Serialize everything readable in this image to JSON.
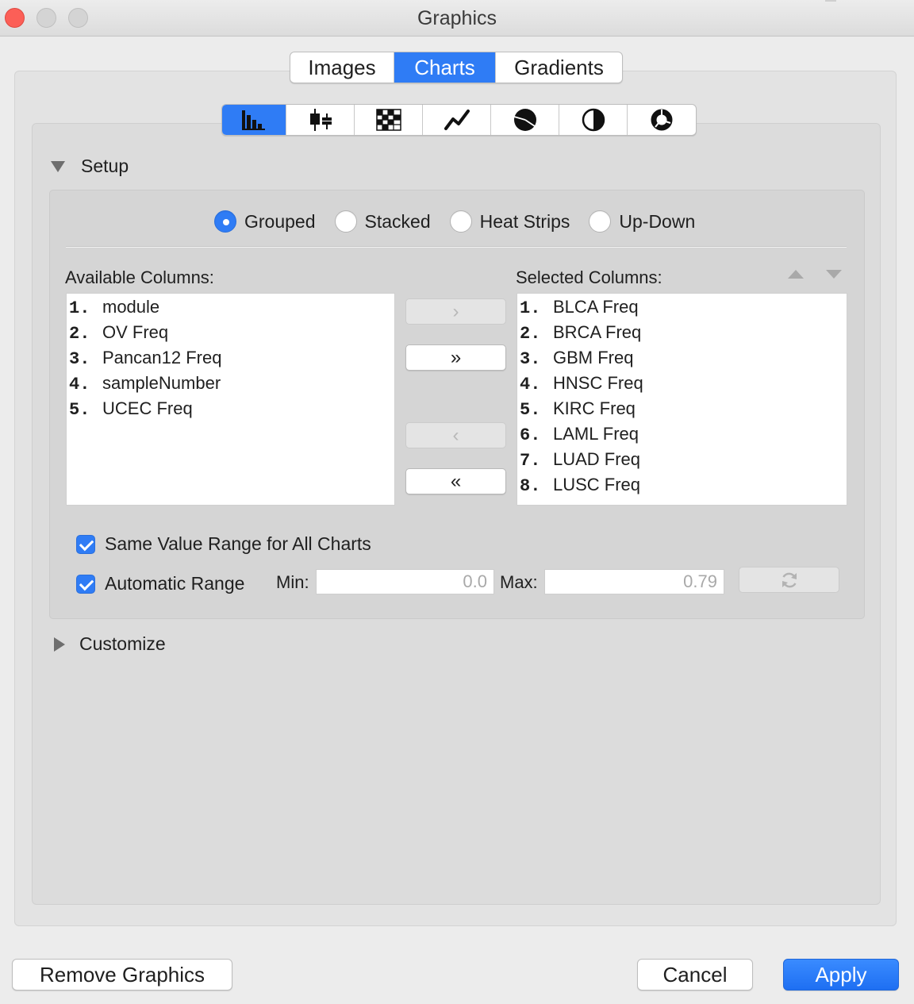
{
  "window": {
    "title": "Graphics"
  },
  "main_tabs": [
    {
      "label": "Images",
      "active": false
    },
    {
      "label": "Charts",
      "active": true
    },
    {
      "label": "Gradients",
      "active": false
    }
  ],
  "chart_types": [
    {
      "icon": "bar-chart-icon",
      "active": true
    },
    {
      "icon": "box-plot-icon",
      "active": false
    },
    {
      "icon": "heat-map-icon",
      "active": false
    },
    {
      "icon": "line-chart-icon",
      "active": false
    },
    {
      "icon": "pie-chart-icon",
      "active": false
    },
    {
      "icon": "stripe-chart-icon",
      "active": false
    },
    {
      "icon": "ring-chart-icon",
      "active": false
    }
  ],
  "setup": {
    "title": "Setup",
    "layout_options": [
      {
        "label": "Grouped",
        "selected": true
      },
      {
        "label": "Stacked",
        "selected": false
      },
      {
        "label": "Heat Strips",
        "selected": false
      },
      {
        "label": "Up-Down",
        "selected": false
      }
    ],
    "available_label": "Available Columns:",
    "selected_label": "Selected Columns:",
    "available_columns": [
      {
        "num": "1.",
        "name": "module"
      },
      {
        "num": "2.",
        "name": "OV Freq"
      },
      {
        "num": "3.",
        "name": "Pancan12 Freq"
      },
      {
        "num": "4.",
        "name": "sampleNumber"
      },
      {
        "num": "5.",
        "name": "UCEC Freq"
      }
    ],
    "selected_columns": [
      {
        "num": "1.",
        "name": "BLCA Freq"
      },
      {
        "num": "2.",
        "name": "BRCA Freq"
      },
      {
        "num": "3.",
        "name": "GBM Freq"
      },
      {
        "num": "4.",
        "name": "HNSC Freq"
      },
      {
        "num": "5.",
        "name": "KIRC Freq"
      },
      {
        "num": "6.",
        "name": "LAML Freq"
      },
      {
        "num": "7.",
        "name": "LUAD Freq"
      },
      {
        "num": "8.",
        "name": "LUSC Freq"
      }
    ],
    "move_buttons": {
      "add": "›",
      "add_all": "»",
      "remove": "‹",
      "remove_all": "«"
    },
    "same_range_label": "Same Value Range for All Charts",
    "same_range_checked": true,
    "auto_range_label": "Automatic Range",
    "auto_range_checked": true,
    "min_label": "Min:",
    "min_value": "0.0",
    "max_label": "Max:",
    "max_value": "0.79"
  },
  "customize": {
    "title": "Customize"
  },
  "footer": {
    "remove_label": "Remove Graphics",
    "cancel_label": "Cancel",
    "apply_label": "Apply"
  },
  "colors": {
    "accent": "#2f7cf5",
    "close": "#fc5f57"
  }
}
